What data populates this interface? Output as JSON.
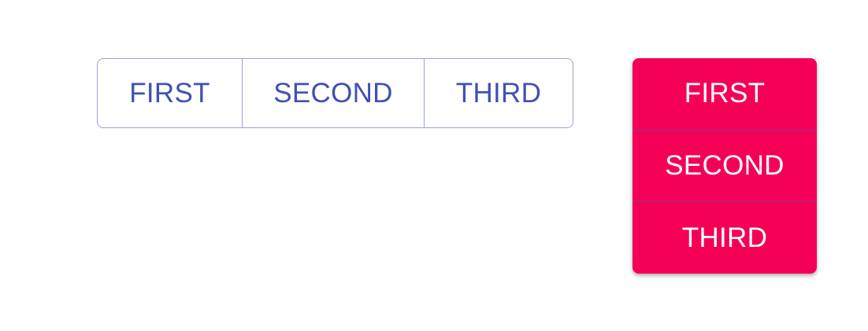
{
  "horizontal_group": {
    "buttons": [
      {
        "label": "FIRST"
      },
      {
        "label": "SECOND"
      },
      {
        "label": "THIRD"
      }
    ],
    "variant": "outlined",
    "color": "#3f51b5",
    "border_color": "#9aa3d9"
  },
  "vertical_group": {
    "buttons": [
      {
        "label": "FIRST"
      },
      {
        "label": "SECOND"
      },
      {
        "label": "THIRD"
      }
    ],
    "variant": "contained",
    "background_color": "#f50057",
    "text_color": "#ffffff",
    "divider_color": "#7a3f8f"
  }
}
